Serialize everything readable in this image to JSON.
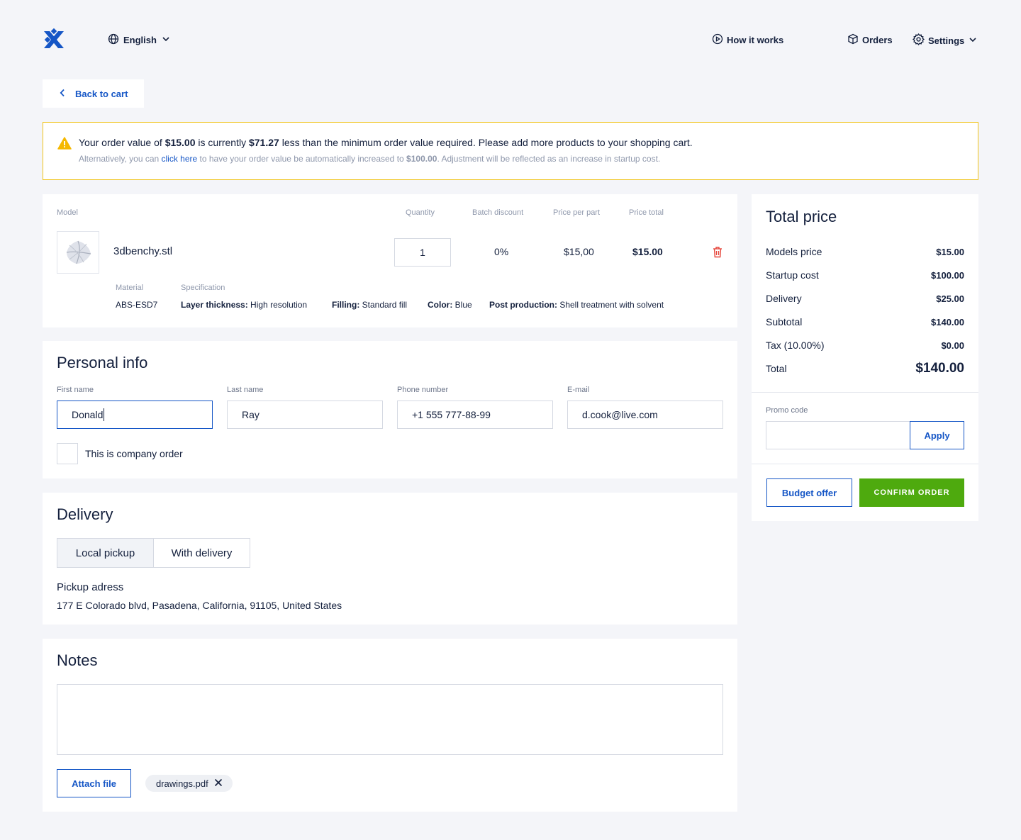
{
  "header": {
    "language": "English",
    "nav": {
      "how_it_works": "How it works",
      "orders": "Orders",
      "settings": "Settings"
    }
  },
  "back_button": "Back to cart",
  "alert": {
    "line1_a": "Your order value of ",
    "order_value": "$15.00",
    "line1_b": " is currently ",
    "shortfall": "$71.27",
    "line1_c": " less than the minimum order value required. Please add more products to your shopping cart.",
    "line2_a": "Alternatively, you can ",
    "link": "click here",
    "line2_b": " to have your order value be automatically increased to ",
    "increase_to": "$100.00",
    "line2_c": ". Adjustment will be reflected as an increase in startup cost."
  },
  "cart": {
    "columns": {
      "model": "Model",
      "quantity": "Quantity",
      "batch_discount": "Batch discount",
      "price_per_part": "Price per part",
      "price_total": "Price total"
    },
    "item": {
      "name": "3dbenchy.stl",
      "quantity": "1",
      "batch_discount": "0%",
      "price_per_part": "$15,00",
      "price_total": "$15.00",
      "material_label": "Material",
      "material": "ABS-ESD7",
      "spec_label": "Specification",
      "specs": [
        {
          "label": "Layer thickness:",
          "value": " High resolution"
        },
        {
          "label": "Filling:",
          "value": " Standard fill"
        },
        {
          "label": "Color:",
          "value": " Blue"
        },
        {
          "label": "Post production:",
          "value": " Shell treatment with solvent"
        }
      ]
    }
  },
  "personal": {
    "title": "Personal info",
    "first_name_label": "First name",
    "first_name": "Donald",
    "last_name_label": "Last name",
    "last_name": "Ray",
    "phone_label": "Phone number",
    "phone": "+1 555 777-88-99",
    "email_label": "E-mail",
    "email": "d.cook@live.com",
    "company_checkbox": "This is company order"
  },
  "delivery": {
    "title": "Delivery",
    "options": [
      "Local pickup",
      "With delivery"
    ],
    "selected": "Local pickup",
    "pickup_title": "Pickup adress",
    "pickup_address": "177 E Colorado blvd, Pasadena, California, 91105, United States"
  },
  "notes": {
    "title": "Notes",
    "value": "",
    "attach_button": "Attach file",
    "attachment": "drawings.pdf"
  },
  "summary": {
    "title": "Total price",
    "rows": [
      {
        "label": "Models price",
        "value": "$15.00"
      },
      {
        "label": "Startup cost",
        "value": "$100.00"
      },
      {
        "label": "Delivery",
        "value": "$25.00"
      },
      {
        "label": "Subtotal",
        "value": "$140.00"
      },
      {
        "label": "Tax (10.00%)",
        "value": "$0.00"
      }
    ],
    "total_label": "Total",
    "total_value": "$140.00",
    "promo_label": "Promo code",
    "promo_value": "",
    "apply_button": "Apply",
    "budget_button": "Budget offer",
    "confirm_button": "CONFIRM ORDER"
  },
  "colors": {
    "accent": "#1556c6",
    "confirm": "#4eaa0e",
    "warning": "#f0c419",
    "danger": "#e5473c",
    "background": "#f4f5f9"
  }
}
